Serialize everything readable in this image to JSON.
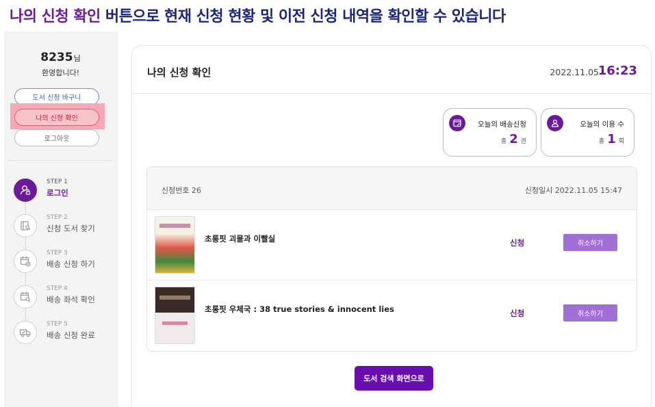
{
  "caption": {
    "highlight": "나의 신청 확인",
    "rest": " 버튼으로 현재 신청 현황 및 이전 신청 내역을 확인할 수 있습니다"
  },
  "sidebar": {
    "user_id": "8235",
    "user_suffix": "님",
    "welcome": "환영합니다!",
    "basket_button": "도서 신청 바구니",
    "my_requests_button": "나의 신청 확인",
    "logout_button": "로그아웃",
    "steps": [
      {
        "num": "STEP 1",
        "label": "로그인",
        "icon": "user-lock-icon",
        "active": true
      },
      {
        "num": "STEP 2",
        "label": "신청 도서 찾기",
        "icon": "book-search-icon",
        "active": false
      },
      {
        "num": "STEP 3",
        "label": "배송 신청 하기",
        "icon": "calendar-add-icon",
        "active": false
      },
      {
        "num": "STEP 4",
        "label": "배송 좌석 확인",
        "icon": "calendar-search-icon",
        "active": false
      },
      {
        "num": "STEP 5",
        "label": "배송 신청 완료",
        "icon": "delivery-truck-icon",
        "active": false
      }
    ]
  },
  "main": {
    "title": "나의 신청 확인",
    "date": "2022.11.05",
    "time": "16:23",
    "stats": {
      "delivery": {
        "label": "오늘의 배송신청",
        "prefix": "총",
        "value": "2",
        "unit": "권",
        "icon": "calendar-check-icon"
      },
      "usage": {
        "label": "오늘의 이용 수",
        "prefix": "총",
        "value": "1",
        "unit": "회",
        "icon": "user-icon"
      }
    },
    "request": {
      "id_label": "신청번호",
      "id_value": "26",
      "date_label": "신청일시",
      "date_value": "2022.11.05 15:47",
      "books": [
        {
          "title": "초롱핏 괴물과 이빨실",
          "status": "신청",
          "cancel": "취소하기"
        },
        {
          "title": "초롱핏 우체국 : 38 true stories & innocent lies",
          "status": "신청",
          "cancel": "취소하기"
        }
      ]
    },
    "search_button": "도서 검색 화면으로"
  },
  "colors": {
    "accent": "#6a1b9a",
    "caption_text": "#1a237e",
    "highlight_box": "#f7a8b4",
    "cancel_button": "#a16fd6"
  }
}
